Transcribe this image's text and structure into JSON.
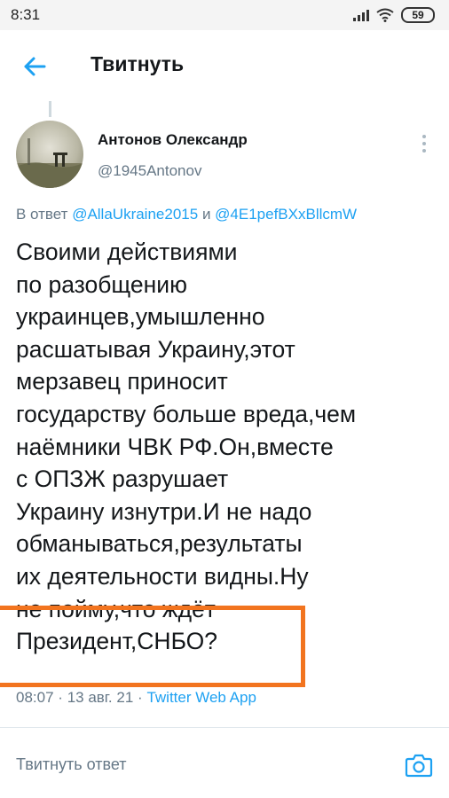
{
  "status_bar": {
    "time": "8:31",
    "battery": "59",
    "icons": [
      "signal-icon",
      "wifi-icon",
      "battery-icon"
    ]
  },
  "header": {
    "title": "Твитнуть",
    "back_icon": "arrow-left-icon"
  },
  "tweet": {
    "author_name": "Антонов Олександр",
    "author_handle": "@1945Antonov",
    "reply_prefix": "В ответ",
    "reply_mention_1": "@AllaUkraine2015",
    "reply_and": "и",
    "reply_mention_2": "@4E1pefBXxBllcmW",
    "text_lines": [
      "Своими действиями",
      "по разобщению",
      "украинцев,умышленно",
      "расшатывая Украину,этот",
      "мерзавец приносит",
      "государству больше вреда,чем",
      "наёмники ЧВК РФ.Он,вместе",
      "с ОПЗЖ разрушает",
      "Украину изнутри.И не надо",
      "обманываться,результаты",
      "их деятельности видны.Ну",
      "не пойму,что ждёт",
      "Президент,СНБО?"
    ],
    "time": "08:07",
    "date": "13 авг. 21",
    "separator": "·",
    "source": "Twitter Web App"
  },
  "reply_bar": {
    "placeholder": "Твитнуть ответ",
    "camera_icon": "camera-icon"
  },
  "colors": {
    "accent": "#1da1f2",
    "secondary_text": "#657786",
    "highlight": "#f2741f"
  }
}
